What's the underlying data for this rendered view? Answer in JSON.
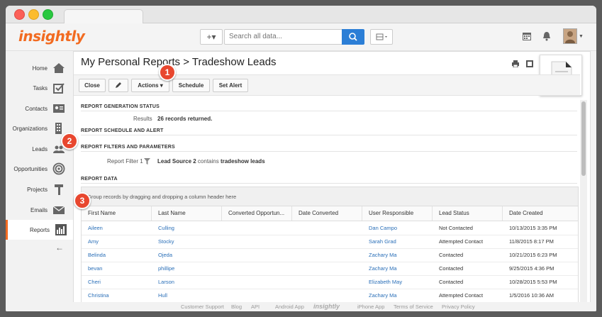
{
  "topbar": {
    "logo": "insightly",
    "add_label": "+▾",
    "search_placeholder": "Search all data...",
    "grid_label": "▦▾"
  },
  "sidebar": {
    "items": [
      {
        "label": "Home"
      },
      {
        "label": "Tasks"
      },
      {
        "label": "Contacts"
      },
      {
        "label": "Organizations"
      },
      {
        "label": "Leads"
      },
      {
        "label": "Opportunities"
      },
      {
        "label": "Projects"
      },
      {
        "label": "Emails"
      },
      {
        "label": "Reports"
      }
    ],
    "back": "←"
  },
  "page": {
    "title": "My Personal Reports > Tradeshow Leads"
  },
  "toolbar": {
    "close": "Close",
    "actions": "Actions ▾",
    "schedule": "Schedule",
    "set_alert": "Set Alert"
  },
  "sections": {
    "generation_status": "REPORT GENERATION STATUS",
    "results_label": "Results",
    "results_value": "26 records returned.",
    "schedule_alert": "REPORT SCHEDULE AND ALERT",
    "filters": "REPORT FILTERS AND PARAMETERS",
    "filter_label": "Report Filter 1",
    "filter_field": "Lead Source 2",
    "filter_op": "contains",
    "filter_value": "tradeshow leads",
    "data": "REPORT DATA"
  },
  "grid": {
    "group_hint": "Group records by dragging and dropping a column header here",
    "columns": [
      "First Name",
      "Last Name",
      "Converted Opportun...",
      "Date Converted",
      "User Responsible",
      "Lead Status",
      "Date Created"
    ],
    "rows": [
      [
        "Aileen",
        "Culling",
        "",
        "",
        "Dan Campo",
        "Not Contacted",
        "10/13/2015 3:35 PM"
      ],
      [
        "Amy",
        "Stocky",
        "",
        "",
        "Sarah Grad",
        "Attempted Contact",
        "11/8/2015 8:17 PM"
      ],
      [
        "Belinda",
        "Ojeda",
        "",
        "",
        "Zachary Ma",
        "Contacted",
        "10/21/2015 6:23 PM"
      ],
      [
        "bevan",
        "phillipe",
        "",
        "",
        "Zachary Ma",
        "Contacted",
        "9/25/2015 4:36 PM"
      ],
      [
        "Cheri",
        "Larson",
        "",
        "",
        "Elizabeth May",
        "Contacted",
        "10/28/2015 5:53 PM"
      ],
      [
        "Christina",
        "Hull",
        "",
        "",
        "Zachary Ma",
        "Attempted Contact",
        "1/5/2016 10:36 AM"
      ]
    ]
  },
  "badges": [
    "1",
    "2",
    "3"
  ],
  "footer": {
    "links": [
      "Customer Support",
      "Blog",
      "API",
      "Android App",
      "insightly",
      "iPhone App",
      "Terms of Service",
      "Privacy Policy"
    ]
  },
  "colors": {
    "brand": "#f26b21",
    "link": "#2a6fb8",
    "badge": "#e8472f",
    "search_button": "#2b7ed6"
  }
}
